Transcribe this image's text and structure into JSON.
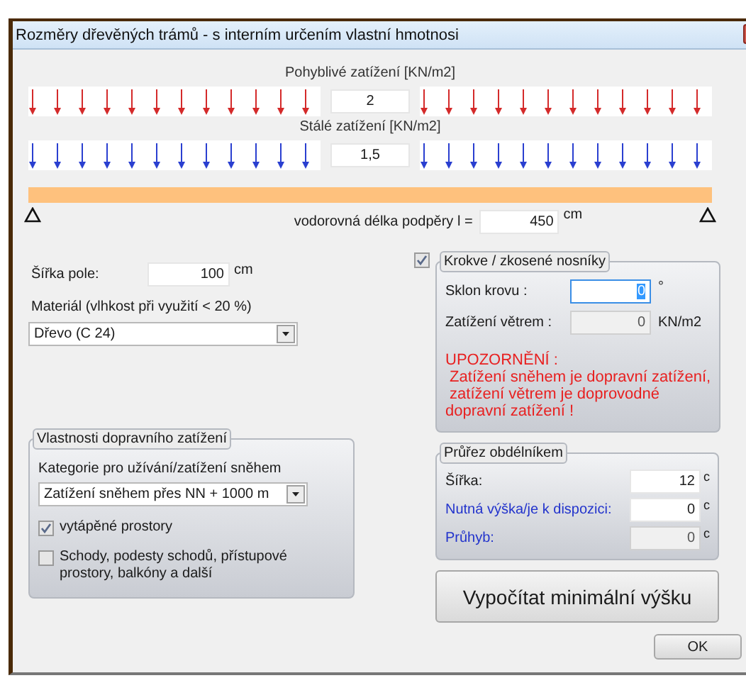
{
  "window": {
    "title": "Rozměry dřevěných trámů - s interním určením vlastní hmotnosi"
  },
  "loads": [
    {
      "label": "Pohyblivé zatížení [KN/m2]",
      "value": "2",
      "color": "#d42a2a"
    },
    {
      "label": "Stálé zatížení [KN/m2]",
      "value": "1,5",
      "color": "#2a3fd0"
    }
  ],
  "span": {
    "label": "vodorovná délka podpěry  l =",
    "value": "450",
    "unit": "cm"
  },
  "field_width": {
    "label": "Šířka pole:",
    "value": "100",
    "unit": "cm"
  },
  "material": {
    "label": "Materiál (vlhkost při využití < 20 %)",
    "value": "Dřevo (C 24)"
  },
  "traffic_load": {
    "title": "Vlastnosti dopravního zatížení",
    "category_label": "Kategorie pro užívání/zatížení sněhem",
    "category": "Zatížení sněhem přes NN + 1000 m",
    "options": [
      {
        "label": "vytápěné prostory",
        "checked": true
      },
      {
        "label": "Schody, podesty schodů, přístupové prostory, balkóny a další",
        "checked": false
      }
    ]
  },
  "rafters": {
    "checked": true,
    "title": "Krokve / zkosené nosníky",
    "fields": [
      {
        "label": "Sklon krovu :",
        "value": "0",
        "unit": "°",
        "disabled": false,
        "focused": true
      },
      {
        "label": "Zatížení větrem :",
        "value": "0",
        "unit": "KN/m2",
        "disabled": true,
        "focused": false
      }
    ],
    "warning_title": "UPOZORNĚNÍ :",
    "warning_lines": [
      " Zatížení sněhem je dopravní zatížení,",
      " zatížení větrem je doprovodné",
      "dopravní zatížení !"
    ]
  },
  "cross_section": {
    "title": "Průřez obdélníkem",
    "fields": [
      {
        "label": "Šířka:",
        "value": "12",
        "unit": "c",
        "color": "#1a1a1a",
        "disabled": false
      },
      {
        "label": "Nutná výška/je k dispozici:",
        "value": "0",
        "unit": "c",
        "color": "#2233cc",
        "disabled": false
      },
      {
        "label": "Průhyb:",
        "value": "0",
        "unit": "c",
        "color": "#2233cc",
        "disabled": true
      }
    ]
  },
  "buttons": {
    "calculate": "Vypočítat minimální výšku",
    "ok": "OK"
  }
}
